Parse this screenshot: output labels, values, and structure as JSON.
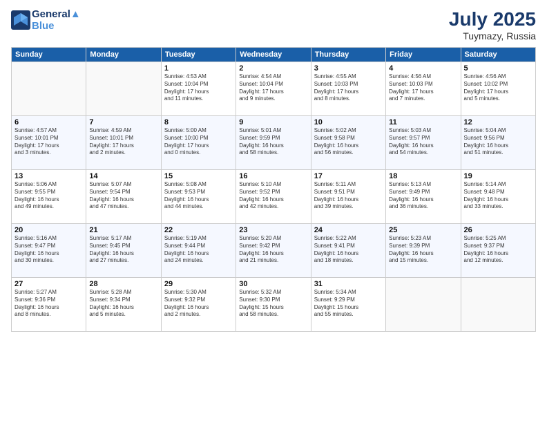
{
  "header": {
    "logo_line1": "General",
    "logo_line2": "Blue",
    "month": "July 2025",
    "location": "Tuymazy, Russia"
  },
  "weekdays": [
    "Sunday",
    "Monday",
    "Tuesday",
    "Wednesday",
    "Thursday",
    "Friday",
    "Saturday"
  ],
  "weeks": [
    [
      {
        "day": "",
        "info": ""
      },
      {
        "day": "",
        "info": ""
      },
      {
        "day": "1",
        "info": "Sunrise: 4:53 AM\nSunset: 10:04 PM\nDaylight: 17 hours\nand 11 minutes."
      },
      {
        "day": "2",
        "info": "Sunrise: 4:54 AM\nSunset: 10:04 PM\nDaylight: 17 hours\nand 9 minutes."
      },
      {
        "day": "3",
        "info": "Sunrise: 4:55 AM\nSunset: 10:03 PM\nDaylight: 17 hours\nand 8 minutes."
      },
      {
        "day": "4",
        "info": "Sunrise: 4:56 AM\nSunset: 10:03 PM\nDaylight: 17 hours\nand 7 minutes."
      },
      {
        "day": "5",
        "info": "Sunrise: 4:56 AM\nSunset: 10:02 PM\nDaylight: 17 hours\nand 5 minutes."
      }
    ],
    [
      {
        "day": "6",
        "info": "Sunrise: 4:57 AM\nSunset: 10:01 PM\nDaylight: 17 hours\nand 3 minutes."
      },
      {
        "day": "7",
        "info": "Sunrise: 4:59 AM\nSunset: 10:01 PM\nDaylight: 17 hours\nand 2 minutes."
      },
      {
        "day": "8",
        "info": "Sunrise: 5:00 AM\nSunset: 10:00 PM\nDaylight: 17 hours\nand 0 minutes."
      },
      {
        "day": "9",
        "info": "Sunrise: 5:01 AM\nSunset: 9:59 PM\nDaylight: 16 hours\nand 58 minutes."
      },
      {
        "day": "10",
        "info": "Sunrise: 5:02 AM\nSunset: 9:58 PM\nDaylight: 16 hours\nand 56 minutes."
      },
      {
        "day": "11",
        "info": "Sunrise: 5:03 AM\nSunset: 9:57 PM\nDaylight: 16 hours\nand 54 minutes."
      },
      {
        "day": "12",
        "info": "Sunrise: 5:04 AM\nSunset: 9:56 PM\nDaylight: 16 hours\nand 51 minutes."
      }
    ],
    [
      {
        "day": "13",
        "info": "Sunrise: 5:06 AM\nSunset: 9:55 PM\nDaylight: 16 hours\nand 49 minutes."
      },
      {
        "day": "14",
        "info": "Sunrise: 5:07 AM\nSunset: 9:54 PM\nDaylight: 16 hours\nand 47 minutes."
      },
      {
        "day": "15",
        "info": "Sunrise: 5:08 AM\nSunset: 9:53 PM\nDaylight: 16 hours\nand 44 minutes."
      },
      {
        "day": "16",
        "info": "Sunrise: 5:10 AM\nSunset: 9:52 PM\nDaylight: 16 hours\nand 42 minutes."
      },
      {
        "day": "17",
        "info": "Sunrise: 5:11 AM\nSunset: 9:51 PM\nDaylight: 16 hours\nand 39 minutes."
      },
      {
        "day": "18",
        "info": "Sunrise: 5:13 AM\nSunset: 9:49 PM\nDaylight: 16 hours\nand 36 minutes."
      },
      {
        "day": "19",
        "info": "Sunrise: 5:14 AM\nSunset: 9:48 PM\nDaylight: 16 hours\nand 33 minutes."
      }
    ],
    [
      {
        "day": "20",
        "info": "Sunrise: 5:16 AM\nSunset: 9:47 PM\nDaylight: 16 hours\nand 30 minutes."
      },
      {
        "day": "21",
        "info": "Sunrise: 5:17 AM\nSunset: 9:45 PM\nDaylight: 16 hours\nand 27 minutes."
      },
      {
        "day": "22",
        "info": "Sunrise: 5:19 AM\nSunset: 9:44 PM\nDaylight: 16 hours\nand 24 minutes."
      },
      {
        "day": "23",
        "info": "Sunrise: 5:20 AM\nSunset: 9:42 PM\nDaylight: 16 hours\nand 21 minutes."
      },
      {
        "day": "24",
        "info": "Sunrise: 5:22 AM\nSunset: 9:41 PM\nDaylight: 16 hours\nand 18 minutes."
      },
      {
        "day": "25",
        "info": "Sunrise: 5:23 AM\nSunset: 9:39 PM\nDaylight: 16 hours\nand 15 minutes."
      },
      {
        "day": "26",
        "info": "Sunrise: 5:25 AM\nSunset: 9:37 PM\nDaylight: 16 hours\nand 12 minutes."
      }
    ],
    [
      {
        "day": "27",
        "info": "Sunrise: 5:27 AM\nSunset: 9:36 PM\nDaylight: 16 hours\nand 8 minutes."
      },
      {
        "day": "28",
        "info": "Sunrise: 5:28 AM\nSunset: 9:34 PM\nDaylight: 16 hours\nand 5 minutes."
      },
      {
        "day": "29",
        "info": "Sunrise: 5:30 AM\nSunset: 9:32 PM\nDaylight: 16 hours\nand 2 minutes."
      },
      {
        "day": "30",
        "info": "Sunrise: 5:32 AM\nSunset: 9:30 PM\nDaylight: 15 hours\nand 58 minutes."
      },
      {
        "day": "31",
        "info": "Sunrise: 5:34 AM\nSunset: 9:29 PM\nDaylight: 15 hours\nand 55 minutes."
      },
      {
        "day": "",
        "info": ""
      },
      {
        "day": "",
        "info": ""
      }
    ]
  ]
}
